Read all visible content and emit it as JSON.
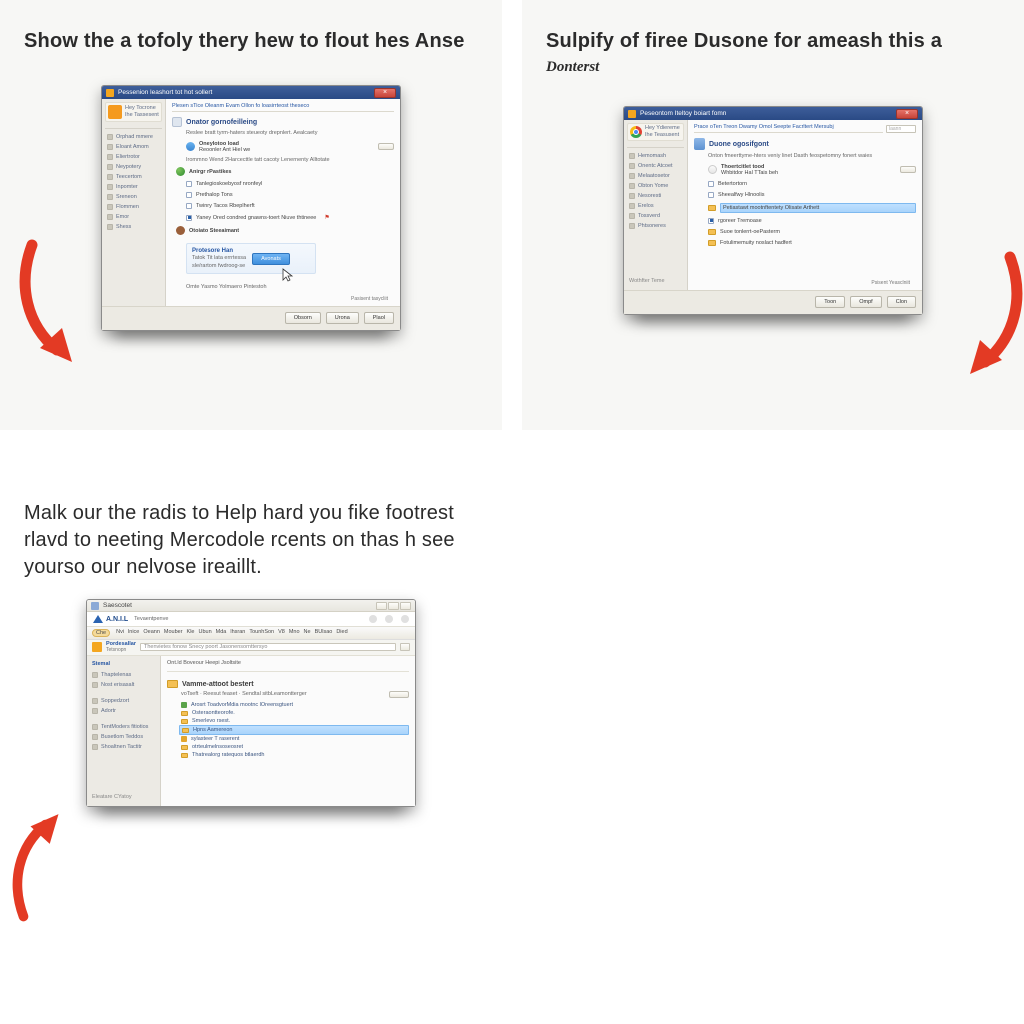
{
  "panels": {
    "p1": {
      "caption": "Show the a tofoly thery hew to flout hes Anse",
      "title": "Pessenion leashort tot hot sollert",
      "tabs": "Plesen  sTice  Oleanm Evam  Ollon fo loasirrteost theseco",
      "sidebar": {
        "hdr1": "Hey Tocrone",
        "hdr2": "Ihe Tassesent",
        "items": [
          "Orphad mmere",
          "Eloant Amom",
          "Eliertrotor",
          "Neypotery",
          "Teecertom",
          "Inpomter",
          "Sreneon",
          "Flommen",
          "Emor",
          "Shess"
        ]
      },
      "section_title": "Onator gornofeilleing",
      "section_sub": "Reslee bratt tyrm-haters steueoty drepnlert. Aealcaety",
      "block_a_icon_title": "Oneylotoo load",
      "block_a_icon_sub": "Reoonler Ant Hiel we",
      "block_a_note": "Irommno Wend 2Harcecttle tatt cacoty Lenernenty Alltotate",
      "block_b_title": "Anirgr rPastikes",
      "opts": [
        "Tanlegioskoebyosf nronfeyl",
        "Prethalop Tons",
        "Twinry Tacos Rbeplherft"
      ],
      "opt_special": "Yaney Ored condred gnawns-toert Niuve thtineee",
      "block_c_title": "Otoiato Steeaimant",
      "promo_title": "Protesore Han",
      "promo_line1": "Tatok Tit lata errrtessa",
      "promo_line2": "sle/rartom fwdroog-se",
      "promo_cta": "Avonats",
      "promo_under": "Omte Yasmo Yolmaero Pintestoh",
      "footer_note": "Pasisent tasycliit",
      "buttons": {
        "b1": "Obsorn",
        "b2": "Urona",
        "b3": "Plaol"
      }
    },
    "p2": {
      "caption": "Sulpify of firee Dusone for ameash this a",
      "caption_sub": "Donterst",
      "title": "Peseontom Iteltoy boiart fomn",
      "tabs": "Prace oTen Treon Dwamy Omol Seepte Facrltert Mersubj",
      "search_placeholder": "laann",
      "sidebar": {
        "hdr1": "Hey Ydiereme",
        "hdr2": "Ihe Teasusent",
        "items": [
          "Hemomash",
          "Onentc Atcoet",
          "Melaatosetor",
          "Obton Yome",
          "Nesoresti",
          "Erelos",
          "Tossverd",
          "Phtsoneres"
        ]
      },
      "section_title": "Duone ogosifgont",
      "section_sub": "Onton fmeerttyme-hters veniy linet Dasth feospetomny fonert waies",
      "block_a_title": "Thoertcitlet tood",
      "block_a_sub": "Whbitdor Hal TTais beh",
      "opt_b1": "Betertortorn",
      "opt_b2": "Sheealfwy Hlnoolis",
      "highlight_row": "Petiastawt mootnftentety Olisate Arthett",
      "f_rows": [
        "rgoreer Tremoase",
        "Suoe tonlerrt-oePasterm",
        "Fotulimemuity noslact hadfert"
      ],
      "footer_note": "Psisent Yeasclniit",
      "buttons": {
        "b1": "Toon",
        "b2": "Ompf",
        "b3": "Clon"
      }
    },
    "p3": {
      "caption": "Malk our the radis to Help hard you fike footrest rlavd to neeting Mercodole rcents on thas h see yourso our nelvose ireaillt.",
      "title": "Saescotet",
      "brand": "A.N.I.L",
      "brand_sub": "Tevaentpenve",
      "menu": [
        "Nvi",
        "lnice",
        "Oeann",
        "Mouber",
        "Kle",
        "Ubun",
        "Mda",
        "lhsran",
        "TounhSon",
        "V8",
        "Mno",
        "Ne",
        "BUlsao",
        "Died"
      ],
      "pill": "Che",
      "address_lbl": "Pordesallar",
      "address_lbl2": "Tetsnopn",
      "address_val": "Thenvietes fonow Snecy poort Jasonensornttersyo",
      "tabline": "Ont.ld Boveour   Heepi Jsoltsite",
      "sidebar2": {
        "hdr": "Stemal",
        "items": [
          "Thaptelenas",
          "Nost erisasalt",
          "Soppedzort",
          "Adortr",
          "TentModers fitiotios",
          "Busetlom Teddos",
          "Shoaltnen Tactitr"
        ]
      },
      "section_title": "Vamme-attoot bestert",
      "section_sub": "voTseft · Reesut feaset · Sendtal sitbLeamontterger",
      "rows": [
        "Arosrt ToadvorMdia mootnc lOreensgtuert",
        "Osteraontteorofe.",
        "Smerlevo rsest.",
        "Hpns Aamereon",
        "sylasteer T raserent",
        "otrteulmelnsoseosret",
        "Thatrealorg ratequos btlaerdh"
      ],
      "footer_link": "Eleatare CYatoy"
    }
  }
}
